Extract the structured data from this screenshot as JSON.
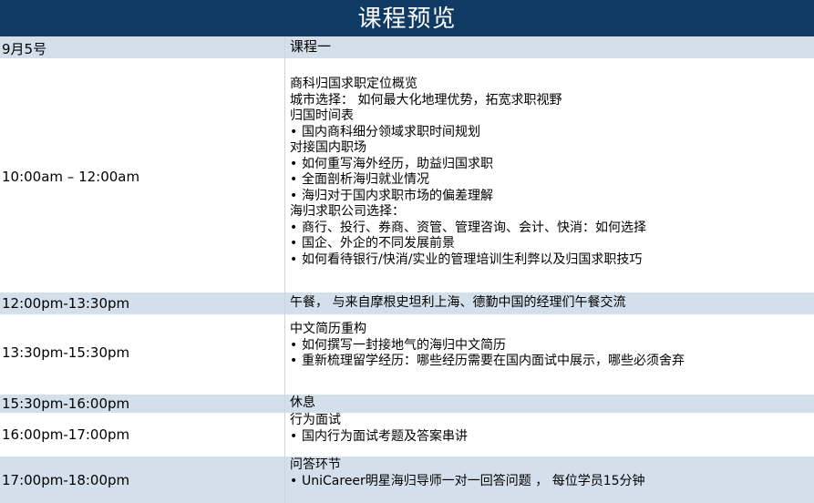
{
  "title": "课程预览",
  "header": {
    "date": "9月5号",
    "course": "课程一"
  },
  "rows": [
    {
      "time": "10:00am – 12:00am",
      "lines": [
        {
          "text": "商科归国求职定位概览",
          "bullet": false
        },
        {
          "text": "城市选择： 如何最大化地理优势，拓宽求职视野",
          "bullet": false
        },
        {
          "text": "归国时间表",
          "bullet": false
        },
        {
          "text": "国内商科细分领域求职时间规划",
          "bullet": true
        },
        {
          "text": "对接国内职场",
          "bullet": false
        },
        {
          "text": "如何重写海外经历，助益归国求职",
          "bullet": true
        },
        {
          "text": "全面剖析海归就业情况",
          "bullet": true
        },
        {
          "text": "海归对于国内求职市场的偏差理解",
          "bullet": true
        },
        {
          "text": "海归求职公司选择：",
          "bullet": false
        },
        {
          "text": "商行、投行、券商、资管、管理咨询、会计、快消：如何选择",
          "bullet": true
        },
        {
          "text": "国企、外企的不同发展前景",
          "bullet": true
        },
        {
          "text": "如何看待银行/快消/实业的管理培训生利弊以及归国求职技巧",
          "bullet": true
        }
      ]
    },
    {
      "time": "12:00pm-13:30pm",
      "lines": [
        {
          "text": "午餐， 与来自摩根史坦利上海、德勤中国的经理们午餐交流",
          "bullet": false
        }
      ]
    },
    {
      "time": "13:30pm-15:30pm",
      "lines": [
        {
          "text": "中文简历重构",
          "bullet": false
        },
        {
          "text": "如何撰写一封接地气的海归中文简历",
          "bullet": true
        },
        {
          "text": "重新梳理留学经历：哪些经历需要在国内面试中展示，哪些必须舍弃",
          "bullet": true
        }
      ]
    },
    {
      "time": "15:30pm-16:00pm",
      "lines": [
        {
          "text": "休息",
          "bullet": false
        }
      ]
    },
    {
      "time": "16:00pm-17:00pm",
      "lines": [
        {
          "text": "行为面试",
          "bullet": false
        },
        {
          "text": "国内行为面试考题及答案串讲",
          "bullet": true
        }
      ]
    },
    {
      "time": "17:00pm-18:00pm",
      "lines": [
        {
          "text": "问答环节",
          "bullet": false
        },
        {
          "text": "UniCareer明星海归导师一对一回答问题 ， 每位学员15分钟",
          "bullet": true
        }
      ]
    }
  ],
  "bullet_char": "•"
}
